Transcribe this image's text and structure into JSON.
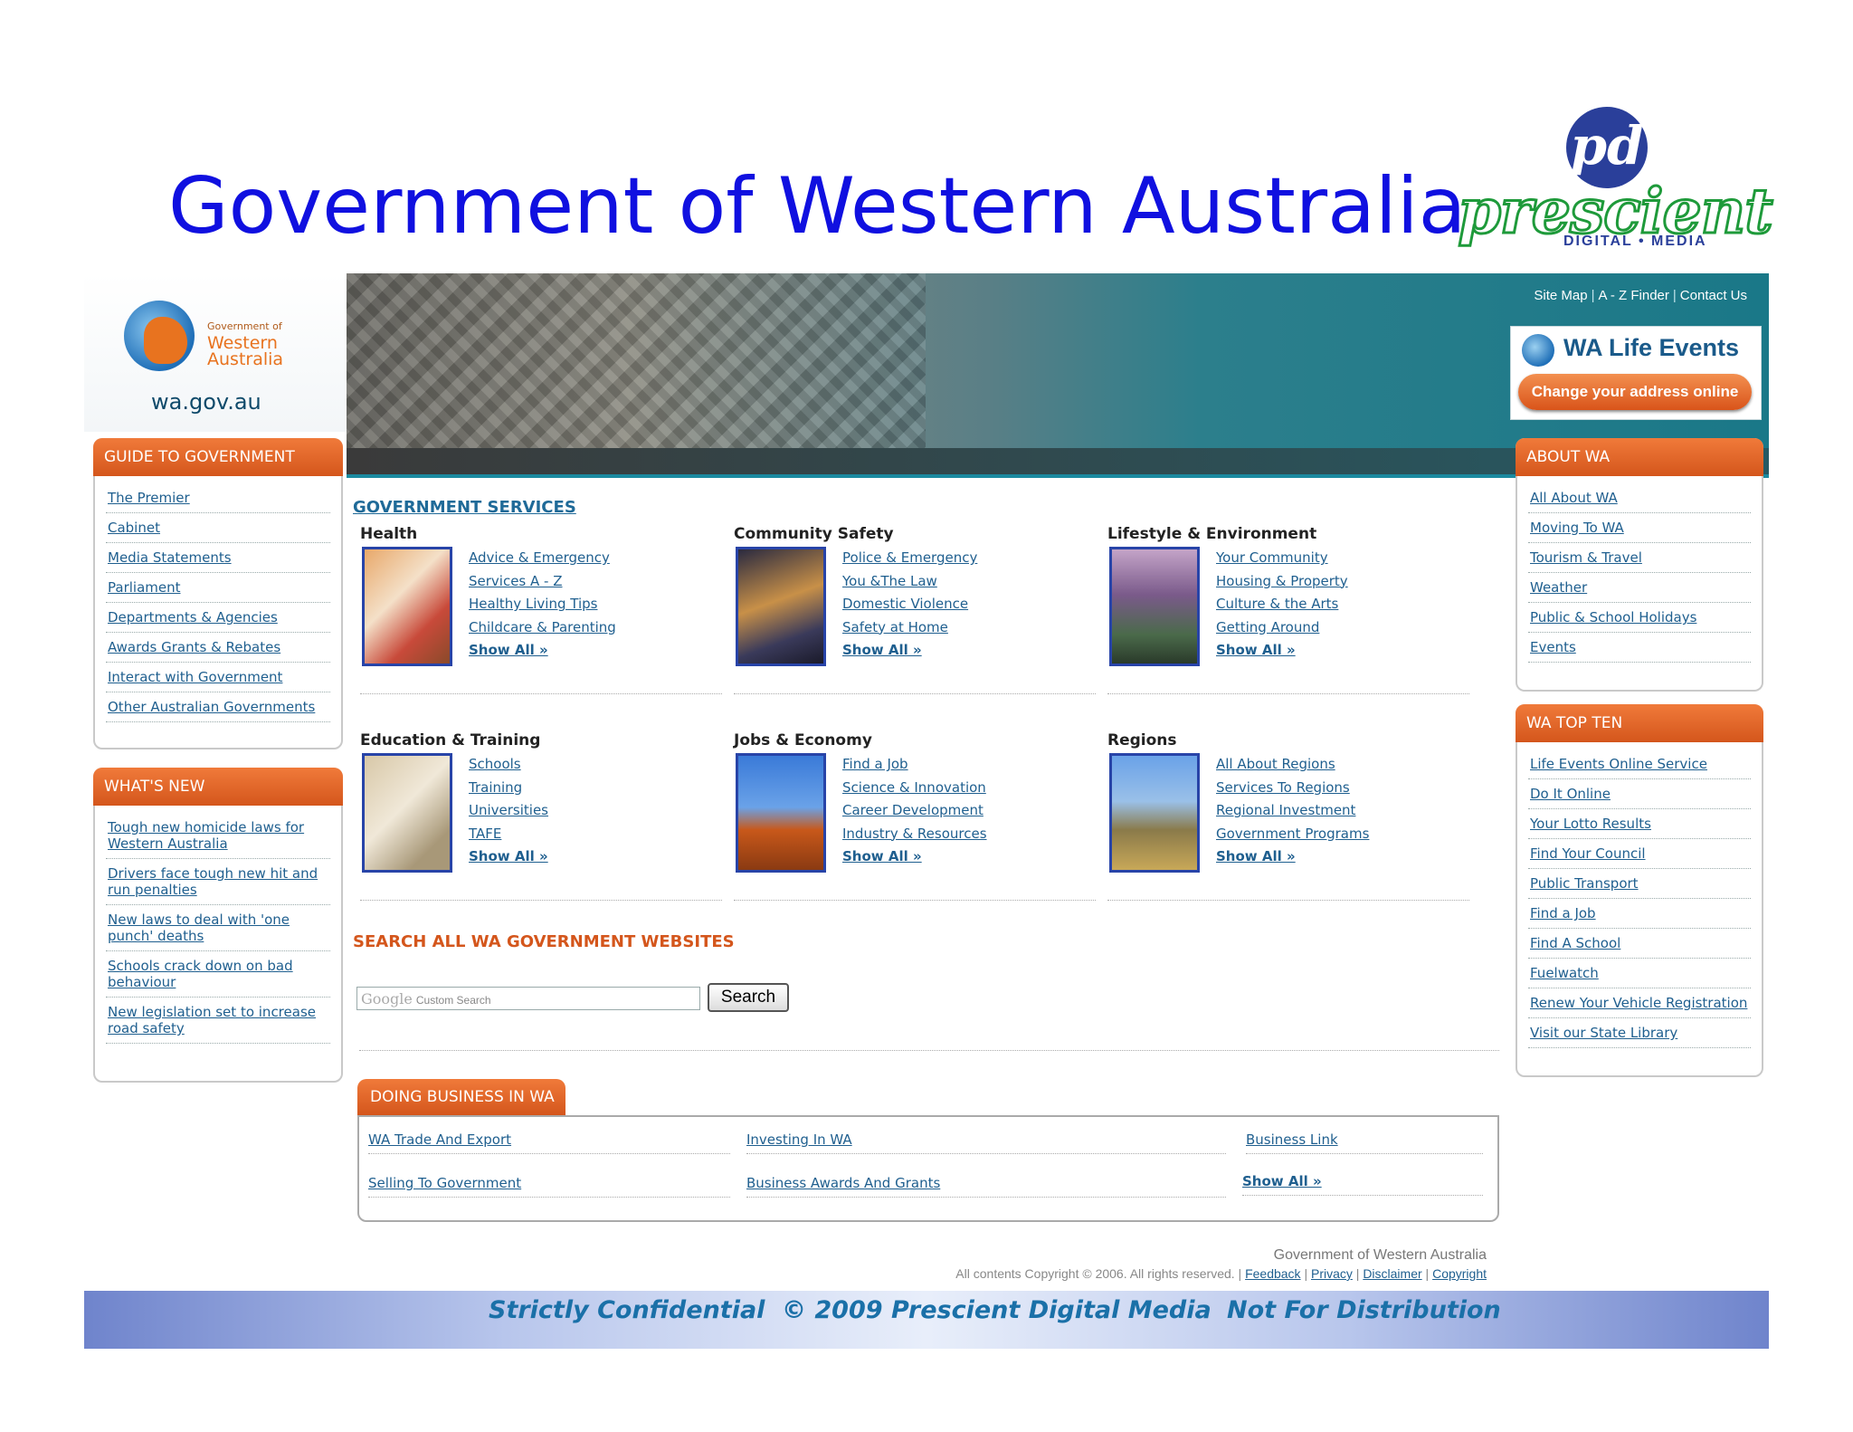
{
  "slide": {
    "title": "Government of Western Australia",
    "logo_monogram": "pd",
    "logo_word": "prescient",
    "logo_sub": "DIGITAL • MEDIA"
  },
  "header": {
    "brand_small": "Government of",
    "brand_line1": "Western",
    "brand_line2": "Australia",
    "url": "wa.gov.au",
    "top_links": [
      "Site Map",
      "A - Z Finder",
      "Contact Us"
    ],
    "life_events_title": "WA Life Events",
    "life_events_button": "Change your address online"
  },
  "guide": {
    "title": "GUIDE TO GOVERNMENT",
    "items": [
      "The Premier",
      "Cabinet",
      "Media Statements",
      "Parliament",
      "Departments & Agencies",
      "Awards Grants & Rebates",
      "Interact with Government",
      "Other Australian Governments"
    ]
  },
  "whats_new": {
    "title": "WHAT'S NEW",
    "items": [
      "Tough new homicide laws for Western Australia",
      "Drivers face tough new hit and run penalties",
      "New laws to deal with 'one punch' deaths",
      "Schools crack down on bad behaviour",
      "New legislation set to increase road safety"
    ]
  },
  "services": {
    "title": "GOVERNMENT SERVICES",
    "groups": [
      {
        "title": "Health",
        "links": [
          "Advice & Emergency",
          "Services A - Z",
          "Healthy Living Tips",
          "Childcare & Parenting"
        ],
        "more": "Show All »"
      },
      {
        "title": "Community Safety",
        "links": [
          "Police & Emergency",
          "You &The Law",
          "Domestic Violence",
          "Safety at Home"
        ],
        "more": "Show All »"
      },
      {
        "title": "Lifestyle & Environment",
        "links": [
          "Your Community",
          "Housing & Property",
          "Culture & the Arts",
          "Getting Around"
        ],
        "more": "Show All »"
      },
      {
        "title": "Education & Training",
        "links": [
          "Schools",
          "Training",
          "Universities",
          "TAFE"
        ],
        "more": "Show All »"
      },
      {
        "title": "Jobs & Economy",
        "links": [
          "Find a Job",
          "Science & Innovation",
          "Career Development",
          "Industry & Resources"
        ],
        "more": "Show All »"
      },
      {
        "title": "Regions",
        "links": [
          "All About Regions",
          "Services To Regions",
          "Regional Investment",
          "Government Programs"
        ],
        "more": "Show All »"
      }
    ]
  },
  "search": {
    "title": "SEARCH ALL WA GOVERNMENT WEBSITES",
    "google": "Google",
    "placeholder": "Custom Search",
    "button": "Search"
  },
  "business": {
    "title": "DOING BUSINESS IN WA",
    "links": [
      "WA Trade And Export",
      "Investing In WA",
      "Business Link",
      "Selling To Government",
      "Business Awards And Grants",
      "Show All »"
    ]
  },
  "about": {
    "title": "ABOUT WA",
    "items": [
      "All About WA",
      "Moving To WA",
      "Tourism & Travel",
      "Weather",
      "Public & School Holidays",
      "Events"
    ]
  },
  "top_ten": {
    "title": "WA TOP TEN",
    "items": [
      "Life Events Online Service",
      "Do It Online",
      "Your Lotto Results",
      "Find Your Council",
      "Public Transport",
      "Find a Job",
      "Find A School",
      "Fuelwatch",
      "Renew Your Vehicle Registration",
      "Visit our State Library"
    ]
  },
  "footer": {
    "org": "Government of Western Australia",
    "copyright": "All contents Copyright © 2006. All rights reserved.",
    "links": [
      "Feedback",
      "Privacy",
      "Disclaimer",
      "Copyright"
    ],
    "band": [
      "Strictly Confidential",
      "© 2009 Prescient Digital Media",
      "Not For Distribution"
    ]
  }
}
